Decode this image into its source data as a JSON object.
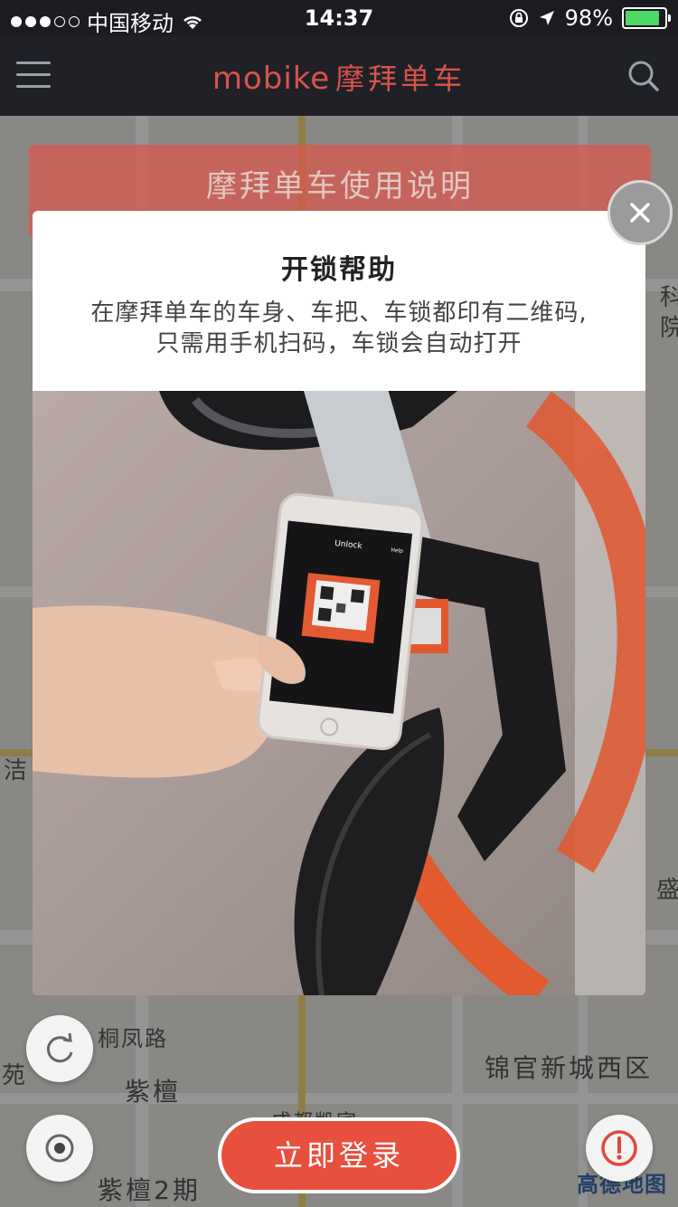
{
  "status_bar": {
    "carrier": "中国移动",
    "time": "14:37",
    "battery": "98%",
    "signal_dots_filled": 3,
    "signal_dots_total": 5,
    "battery_level": 0.98
  },
  "nav": {
    "brand_en": "mobike",
    "brand_cn": "摩拜单车",
    "menu_icon": "hamburger-icon",
    "search_icon": "search-icon"
  },
  "banner": {
    "title": "摩拜单车使用说明"
  },
  "modal": {
    "title": "开锁帮助",
    "desc_line1": "在摩拜单车的车身、车把、车锁都印有二维码,",
    "desc_line2": "只需用手机扫码，车锁会自动打开",
    "close_icon": "close-icon"
  },
  "phone_screen": {
    "title": "Unlock",
    "help": "Help"
  },
  "map": {
    "labels": {
      "l1": "桐凤路",
      "l2": "紫檀",
      "l3": "紫檀2期",
      "l4": "锦官新城西区",
      "l5": "成都凯宾",
      "l6": "苑",
      "l7": "洁",
      "l8": "科",
      "l9": "院",
      "l10": "盛"
    },
    "attribution": "高德地图"
  },
  "actions": {
    "login": "立即登录",
    "refresh_icon": "refresh-icon",
    "locate_icon": "locate-icon",
    "report_icon": "alert-icon"
  },
  "colors": {
    "brand": "#e8503e",
    "navbar": "#1f2127",
    "battery": "#4cd964"
  }
}
